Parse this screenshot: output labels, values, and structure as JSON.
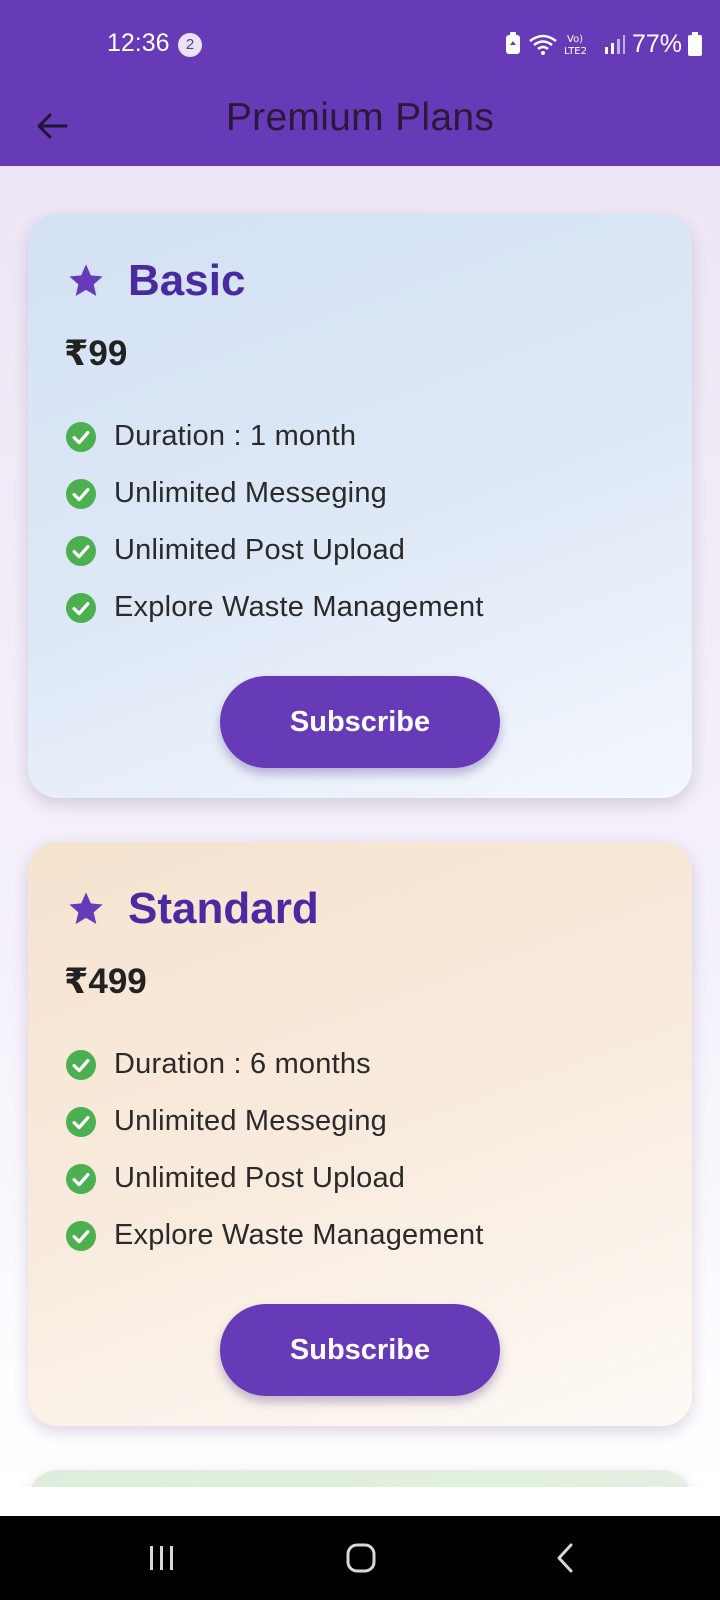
{
  "status_bar": {
    "time": "12:36",
    "notification_count": "2",
    "battery_percent": "77%",
    "network_label": "Vo) LTE2"
  },
  "app_bar": {
    "title": "Premium Plans",
    "back_icon": "arrow-left-icon"
  },
  "plans": [
    {
      "name": "Basic",
      "price": "₹99",
      "features": [
        "Duration : 1 month",
        "Unlimited Messeging",
        "Unlimited Post Upload",
        "Explore Waste Management"
      ],
      "button_label": "Subscribe"
    },
    {
      "name": "Standard",
      "price": "₹499",
      "features": [
        "Duration : 6 months",
        "Unlimited Messeging",
        "Unlimited Post Upload",
        "Explore Waste Management"
      ],
      "button_label": "Subscribe"
    }
  ],
  "colors": {
    "primary": "#673ab7",
    "plan_title": "#4a2aa0",
    "check": "#4caf50",
    "basic_card": "#d3e1f4",
    "standard_card": "#f6e3d0",
    "premium_card": "#dfeedc"
  },
  "nav_bar": {
    "recents_icon": "recents-icon",
    "home_icon": "home-icon",
    "back_icon": "back-chevron-icon"
  }
}
